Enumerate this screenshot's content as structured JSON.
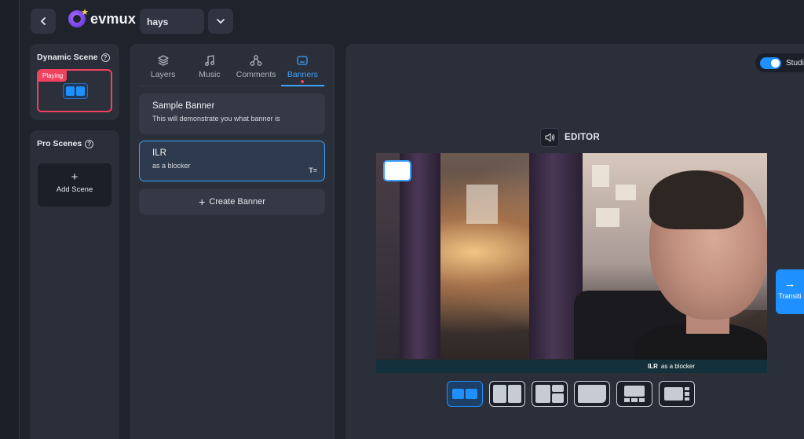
{
  "app": {
    "logo_text": "evmux",
    "project_name": "hays"
  },
  "dynamic_scene": {
    "title": "Dynamic Scene",
    "help_icon": "?",
    "playing_label": "Playing"
  },
  "pro_scenes": {
    "title": "Pro Scenes",
    "help_icon": "?",
    "add_icon": "+",
    "add_label": "Add Scene"
  },
  "tabs": [
    {
      "label": "Layers",
      "icon": "layers-icon"
    },
    {
      "label": "Music",
      "icon": "music-icon"
    },
    {
      "label": "Comments",
      "icon": "comments-icon"
    },
    {
      "label": "Banners",
      "icon": "banner-icon",
      "active": true
    }
  ],
  "banners": [
    {
      "title": "Sample Banner",
      "subtitle": "This will demonstrate you what banner is"
    },
    {
      "title": "ILR",
      "subtitle": "as a blocker",
      "selected": true
    }
  ],
  "create_banner": {
    "icon": "+",
    "label": "Create Banner"
  },
  "editor": {
    "label": "EDITOR",
    "studio_toggle_label": "Studi",
    "studio_toggle_on": true,
    "live_banner": {
      "title": "ILR",
      "subtitle": "as a blocker"
    },
    "transition_icon": "→",
    "transition_label": "Transiti"
  },
  "text_style_icon": "T=",
  "layouts": [
    "two-side-by-side",
    "two-split",
    "split-quad",
    "single-large",
    "main-bottom-thumbs",
    "main-side-thumbs"
  ],
  "colors": {
    "accent": "#1e90ff",
    "live": "#f0415e",
    "panel": "#2a2f39",
    "background": "#1f232b"
  }
}
